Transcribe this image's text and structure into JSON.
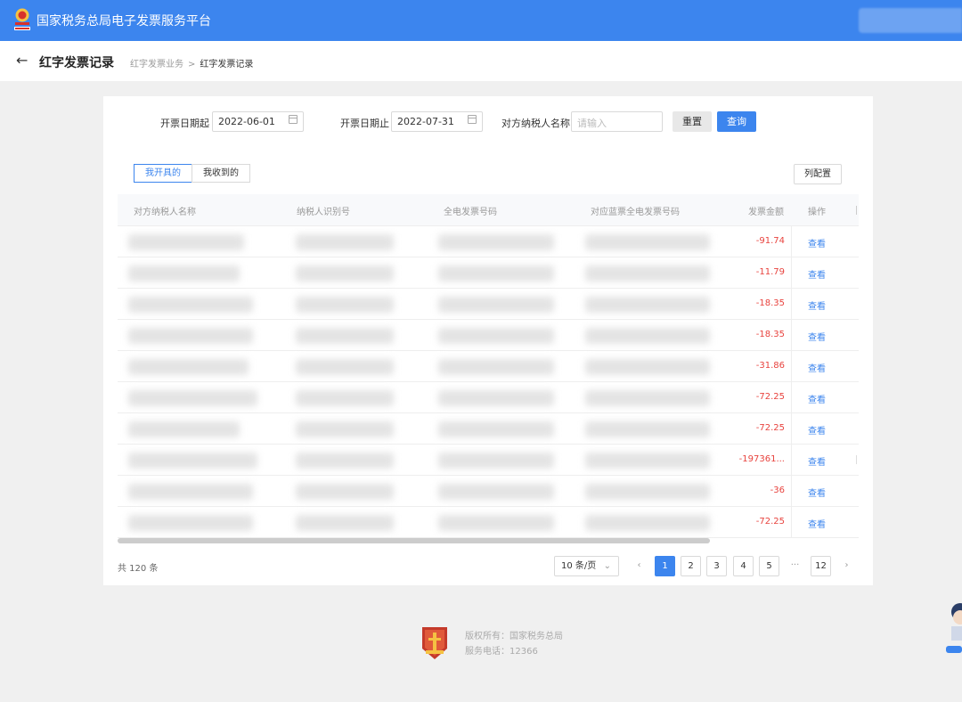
{
  "header": {
    "app_title": "国家税务总局电子发票服务平台"
  },
  "subheader": {
    "back_icon": "arrow-left-icon",
    "page_title": "红字发票记录",
    "breadcrumb": [
      "红字发票业务",
      "红字发票记录"
    ],
    "breadcrumb_separator": ">"
  },
  "filters": {
    "start_label": "开票日期起",
    "start_value": "2022-06-01",
    "end_label": "开票日期止",
    "end_value": "2022-07-31",
    "counterparty_label": "对方纳税人名称",
    "counterparty_placeholder": "请输入",
    "reset_label": "重置",
    "query_label": "查询"
  },
  "tabs": [
    "我开具的",
    "我收到的"
  ],
  "column_config_label": "列配置",
  "table": {
    "columns": [
      "对方纳税人名称",
      "纳税人识别号",
      "全电发票号码",
      "对应蓝票全电发票号码",
      "发票金额",
      "操作"
    ],
    "rows": [
      {
        "amount": "-91.74",
        "action": "查看"
      },
      {
        "amount": "-11.79",
        "action": "查看"
      },
      {
        "amount": "-18.35",
        "action": "查看"
      },
      {
        "amount": "-18.35",
        "action": "查看"
      },
      {
        "amount": "-31.86",
        "action": "查看"
      },
      {
        "amount": "-72.25",
        "action": "查看"
      },
      {
        "amount": "-72.25",
        "action": "查看"
      },
      {
        "amount": "-197361...",
        "action": "查看"
      },
      {
        "amount": "-36",
        "action": "查看"
      },
      {
        "amount": "-72.25",
        "action": "查看"
      }
    ]
  },
  "pagination": {
    "total": "共 120 条",
    "page_size": "10 条/页",
    "prev": "‹",
    "pages": [
      "1",
      "2",
      "3",
      "4",
      "5"
    ],
    "ellipsis": "···",
    "last": "12",
    "next": "›",
    "current": "1"
  },
  "footer": {
    "copyright": "版权所有：国家税务总局",
    "phone": "服务电话：12366"
  },
  "colors": {
    "primary": "#3c85ee",
    "negative_amount": "#e8433e"
  }
}
